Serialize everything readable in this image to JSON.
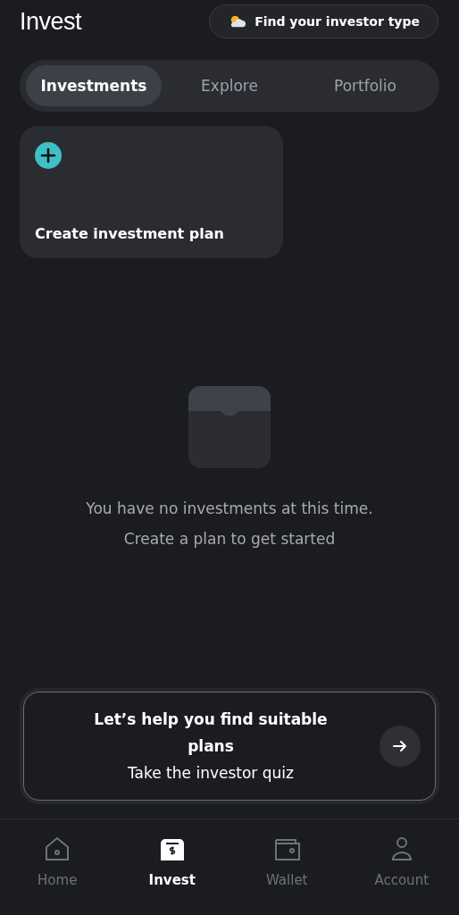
{
  "header": {
    "title": "Invest",
    "quiz_button": "Find your investor type"
  },
  "tabs": [
    {
      "label": "Investments",
      "selected": true
    },
    {
      "label": "Explore",
      "selected": false
    },
    {
      "label": "Portfolio",
      "selected": false
    }
  ],
  "create_card": {
    "label": "Create investment plan"
  },
  "empty_state": {
    "message": "You have no investments at this time.",
    "hint": "Create a plan to get started"
  },
  "quiz_card": {
    "title": "Let’s help you find suitable plans",
    "subtitle": "Take the investor quiz"
  },
  "nav": [
    {
      "kind": "home",
      "label": "Home",
      "selected": false
    },
    {
      "kind": "invest",
      "label": "Invest",
      "selected": true
    },
    {
      "kind": "wallet",
      "label": "Wallet",
      "selected": false
    },
    {
      "kind": "account",
      "label": "Account",
      "selected": false
    }
  ]
}
